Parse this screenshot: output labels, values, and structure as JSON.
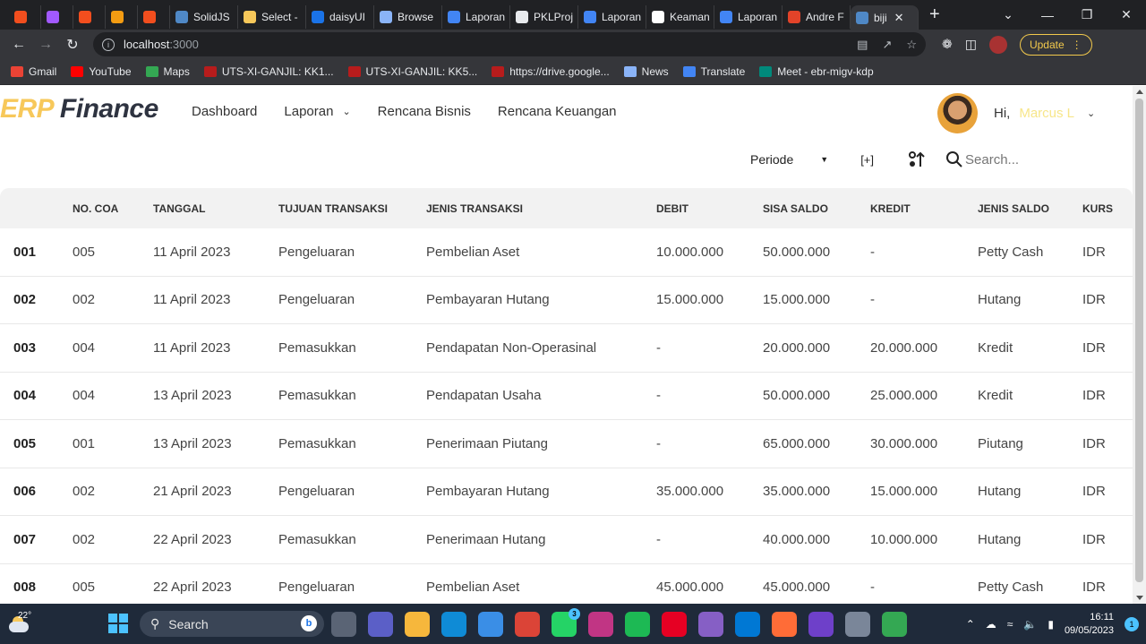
{
  "browser": {
    "tabs": [
      {
        "label": "",
        "color": "#f24e1e"
      },
      {
        "label": "",
        "color": "#a259ff"
      },
      {
        "label": "",
        "color": "#f24e1e"
      },
      {
        "label": "",
        "color": "#f39c12"
      },
      {
        "label": "",
        "color": "#f24e1e"
      },
      {
        "label": "SolidJS",
        "color": "#4f88c6"
      },
      {
        "label": "Select -",
        "color": "#f7c85a"
      },
      {
        "label": "daisyUI",
        "color": "#1a73e8"
      },
      {
        "label": "Browse",
        "color": "#8ab4f8"
      },
      {
        "label": "Laporan",
        "color": "#4285f4"
      },
      {
        "label": "PKLProj",
        "color": "#e8eaed"
      },
      {
        "label": "Laporan",
        "color": "#4285f4"
      },
      {
        "label": "Keaman",
        "color": "#ffffff"
      },
      {
        "label": "Laporan",
        "color": "#4285f4"
      },
      {
        "label": "Andre F",
        "color": "#e24329"
      },
      {
        "label": "biji",
        "color": "#4f88c6",
        "active": true
      }
    ],
    "tab_close": "✕",
    "new_tab": "+",
    "window_controls": [
      "⌄",
      "—",
      "❐",
      "✕"
    ],
    "url_host": "localhost",
    "url_port": ":3000",
    "update_label": "Update",
    "bookmarks": [
      {
        "label": "Gmail",
        "color": "#ea4335"
      },
      {
        "label": "YouTube",
        "color": "#ff0000"
      },
      {
        "label": "Maps",
        "color": "#34a853"
      },
      {
        "label": "UTS-XI-GANJIL: KK1...",
        "color": "#b71c1c"
      },
      {
        "label": "UTS-XI-GANJIL: KK5...",
        "color": "#b71c1c"
      },
      {
        "label": "https://drive.google...",
        "color": "#b71c1c"
      },
      {
        "label": "News",
        "color": "#8ab4f8"
      },
      {
        "label": "Translate",
        "color": "#4285f4"
      },
      {
        "label": "Meet - ebr-migv-kdp",
        "color": "#00897b"
      }
    ]
  },
  "app": {
    "logo_erp": "ERP",
    "logo_finance": "Finance",
    "nav": [
      "Dashboard",
      "Laporan",
      "Rencana Bisnis",
      "Rencana Keuangan"
    ],
    "greeting": "Hi,",
    "user_name": "Marcus L",
    "toolbar": {
      "periode": "Periode",
      "add": "[+]",
      "search_placeholder": "Search..."
    },
    "table": {
      "headers": [
        "NO. COA",
        "TANGGAL",
        "TUJUAN TRANSAKSI",
        "JENIS TRANSAKSI",
        "DEBIT",
        "SISA SALDO",
        "KREDIT",
        "JENIS SALDO",
        "KURS"
      ],
      "rows": [
        {
          "no": "001",
          "coa": "005",
          "tanggal": "11 April 2023",
          "tujuan": "Pengeluaran",
          "jenis": "Pembelian Aset",
          "debit": "10.000.000",
          "sisa": "50.000.000",
          "kredit": "-",
          "jenis_saldo": "Petty Cash",
          "kurs": "IDR"
        },
        {
          "no": "002",
          "coa": "002",
          "tanggal": "11 April 2023",
          "tujuan": "Pengeluaran",
          "jenis": "Pembayaran Hutang",
          "debit": "15.000.000",
          "sisa": "15.000.000",
          "kredit": "-",
          "jenis_saldo": "Hutang",
          "kurs": "IDR"
        },
        {
          "no": "003",
          "coa": "004",
          "tanggal": "11 April 2023",
          "tujuan": "Pemasukkan",
          "jenis": "Pendapatan Non-Operasinal",
          "debit": "-",
          "sisa": "20.000.000",
          "kredit": "20.000.000",
          "jenis_saldo": "Kredit",
          "kurs": "IDR"
        },
        {
          "no": "004",
          "coa": "004",
          "tanggal": "13 April 2023",
          "tujuan": "Pemasukkan",
          "jenis": "Pendapatan Usaha",
          "debit": "-",
          "sisa": "50.000.000",
          "kredit": "25.000.000",
          "jenis_saldo": "Kredit",
          "kurs": "IDR"
        },
        {
          "no": "005",
          "coa": "001",
          "tanggal": "13 April 2023",
          "tujuan": "Pemasukkan",
          "jenis": "Penerimaan Piutang",
          "debit": "-",
          "sisa": "65.000.000",
          "kredit": "30.000.000",
          "jenis_saldo": "Piutang",
          "kurs": "IDR"
        },
        {
          "no": "006",
          "coa": "002",
          "tanggal": "21 April 2023",
          "tujuan": "Pengeluaran",
          "jenis": "Pembayaran Hutang",
          "debit": "35.000.000",
          "sisa": "35.000.000",
          "kredit": "15.000.000",
          "jenis_saldo": "Hutang",
          "kurs": "IDR"
        },
        {
          "no": "007",
          "coa": "002",
          "tanggal": "22 April 2023",
          "tujuan": "Pemasukkan",
          "jenis": "Penerimaan Hutang",
          "debit": "-",
          "sisa": "40.000.000",
          "kredit": "10.000.000",
          "jenis_saldo": "Hutang",
          "kurs": "IDR"
        },
        {
          "no": "008",
          "coa": "005",
          "tanggal": "22 April 2023",
          "tujuan": "Pengeluaran",
          "jenis": "Pembelian Aset",
          "debit": "45.000.000",
          "sisa": "45.000.000",
          "kredit": "-",
          "jenis_saldo": "Petty Cash",
          "kurs": "IDR"
        }
      ]
    }
  },
  "taskbar": {
    "temperature": "22°",
    "search_label": "Search",
    "time": "16:11",
    "date": "09/05/2023",
    "notification_count": "1",
    "whatsapp_badge": "3",
    "apps": [
      {
        "name": "task-view-icon",
        "color": "#5a6475"
      },
      {
        "name": "teams-icon",
        "color": "#5b5fc7"
      },
      {
        "name": "file-explorer-icon",
        "color": "#f6b73c"
      },
      {
        "name": "edge-icon",
        "color": "#0f8bd6"
      },
      {
        "name": "store-icon",
        "color": "#3a8ee6"
      },
      {
        "name": "chrome-icon",
        "color": "#db4437"
      },
      {
        "name": "whatsapp-icon",
        "color": "#25d366"
      },
      {
        "name": "instagram-icon",
        "color": "#c13584"
      },
      {
        "name": "spotify-icon",
        "color": "#1db954"
      },
      {
        "name": "pinterest-icon",
        "color": "#e60023"
      },
      {
        "name": "visual-studio-icon",
        "color": "#865fc5"
      },
      {
        "name": "vscode-icon",
        "color": "#0078d4"
      },
      {
        "name": "postman-icon",
        "color": "#ff6c37"
      },
      {
        "name": "github-desktop-icon",
        "color": "#6e40c9"
      },
      {
        "name": "settings-icon",
        "color": "#7a8699"
      },
      {
        "name": "chrome-profile-icon",
        "color": "#34a853"
      }
    ]
  }
}
